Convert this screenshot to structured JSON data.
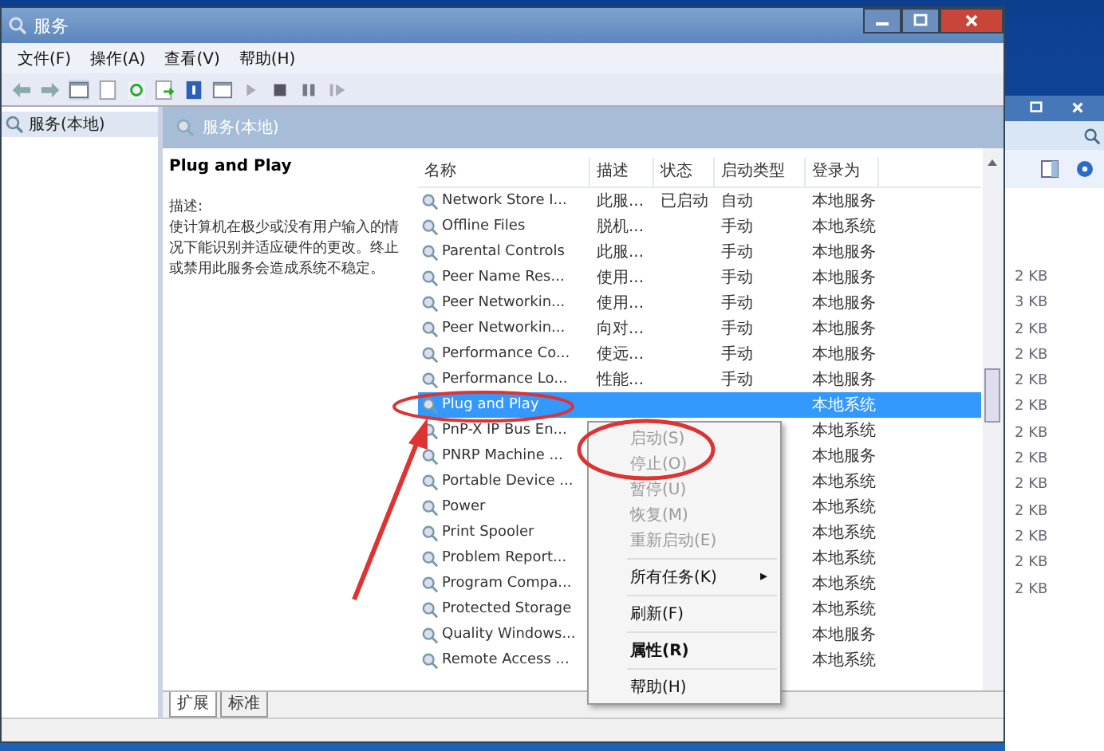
{
  "window": {
    "title": "服务"
  },
  "menu": [
    "文件(F)",
    "操作(A)",
    "查看(V)",
    "帮助(H)"
  ],
  "tree": {
    "items": [
      {
        "label": "服务(本地)",
        "selected": true
      }
    ]
  },
  "header": "服务(本地)",
  "detail": {
    "title": "Plug and Play",
    "label": "描述:",
    "text": "使计算机在极少或没有用户输入的情况下能识别并适应硬件的更改。终止或禁用此服务会造成系统不稳定。"
  },
  "table": {
    "columns": [
      "名称",
      "描述",
      "状态",
      "启动类型",
      "登录为"
    ],
    "rows": [
      {
        "cells": [
          "Network Store I...",
          "此服...",
          "已启动",
          "自动",
          "本地服务"
        ],
        "selected": false
      },
      {
        "cells": [
          "Offline Files",
          "脱机...",
          "",
          "手动",
          "本地系统"
        ],
        "selected": false
      },
      {
        "cells": [
          "Parental Controls",
          "此服...",
          "",
          "手动",
          "本地服务"
        ],
        "selected": false
      },
      {
        "cells": [
          "Peer Name Res...",
          "使用...",
          "",
          "手动",
          "本地服务"
        ],
        "selected": false
      },
      {
        "cells": [
          "Peer Networkin...",
          "使用...",
          "",
          "手动",
          "本地服务"
        ],
        "selected": false
      },
      {
        "cells": [
          "Peer Networkin...",
          "向对...",
          "",
          "手动",
          "本地服务"
        ],
        "selected": false
      },
      {
        "cells": [
          "Performance Co...",
          "使远...",
          "",
          "手动",
          "本地服务"
        ],
        "selected": false
      },
      {
        "cells": [
          "Performance Lo...",
          "性能...",
          "",
          "手动",
          "本地服务"
        ],
        "selected": false
      },
      {
        "cells": [
          "Plug and Play",
          "",
          "",
          "",
          "本地系统"
        ],
        "selected": true
      },
      {
        "cells": [
          "PnP-X IP Bus En...",
          "",
          "",
          "",
          "本地系统"
        ],
        "selected": false
      },
      {
        "cells": [
          "PNRP Machine ...",
          "",
          "",
          "",
          "本地服务"
        ],
        "selected": false
      },
      {
        "cells": [
          "Portable Device ...",
          "",
          "",
          "",
          "本地系统"
        ],
        "selected": false
      },
      {
        "cells": [
          "Power",
          "",
          "",
          "",
          "本地系统"
        ],
        "selected": false
      },
      {
        "cells": [
          "Print Spooler",
          "",
          "",
          "",
          "本地系统"
        ],
        "selected": false
      },
      {
        "cells": [
          "Problem Report...",
          "",
          "",
          "",
          "本地系统"
        ],
        "selected": false
      },
      {
        "cells": [
          "Program Compa...",
          "",
          "",
          "",
          "本地系统"
        ],
        "selected": false
      },
      {
        "cells": [
          "Protected Storage",
          "",
          "",
          "",
          "本地系统"
        ],
        "selected": false
      },
      {
        "cells": [
          "Quality Windows...",
          "",
          "",
          "",
          "本地服务"
        ],
        "selected": false
      },
      {
        "cells": [
          "Remote Access ...",
          "",
          "",
          "",
          "本地系统"
        ],
        "selected": false
      }
    ]
  },
  "context_menu": [
    {
      "kind": "item",
      "label": "启动(S)",
      "disabled": true
    },
    {
      "kind": "item",
      "label": "停止(O)",
      "disabled": true
    },
    {
      "kind": "item",
      "label": "暂停(U)",
      "disabled": true
    },
    {
      "kind": "item",
      "label": "恢复(M)",
      "disabled": true
    },
    {
      "kind": "item",
      "label": "重新启动(E)",
      "disabled": true
    },
    {
      "kind": "separator"
    },
    {
      "kind": "submenu",
      "label": "所有任务(K)",
      "arrow": "▸",
      "disabled": false
    },
    {
      "kind": "separator"
    },
    {
      "kind": "item",
      "label": "刷新(F)",
      "disabled": false
    },
    {
      "kind": "separator"
    },
    {
      "kind": "default",
      "label": "属性(R)",
      "disabled": false
    },
    {
      "kind": "separator"
    },
    {
      "kind": "item",
      "label": "帮助(H)",
      "disabled": false
    }
  ],
  "view_tabs": [
    {
      "label": "扩展",
      "selected": true
    },
    {
      "label": "标准",
      "selected": false
    }
  ],
  "background_window": {
    "sizes": [
      "2 KB",
      "3 KB",
      "2 KB",
      "2 KB",
      "2 KB",
      "2 KB",
      "2 KB",
      "2 KB",
      "2 KB",
      "2 KB",
      "2 KB",
      "2 KB",
      "2 KB"
    ]
  }
}
